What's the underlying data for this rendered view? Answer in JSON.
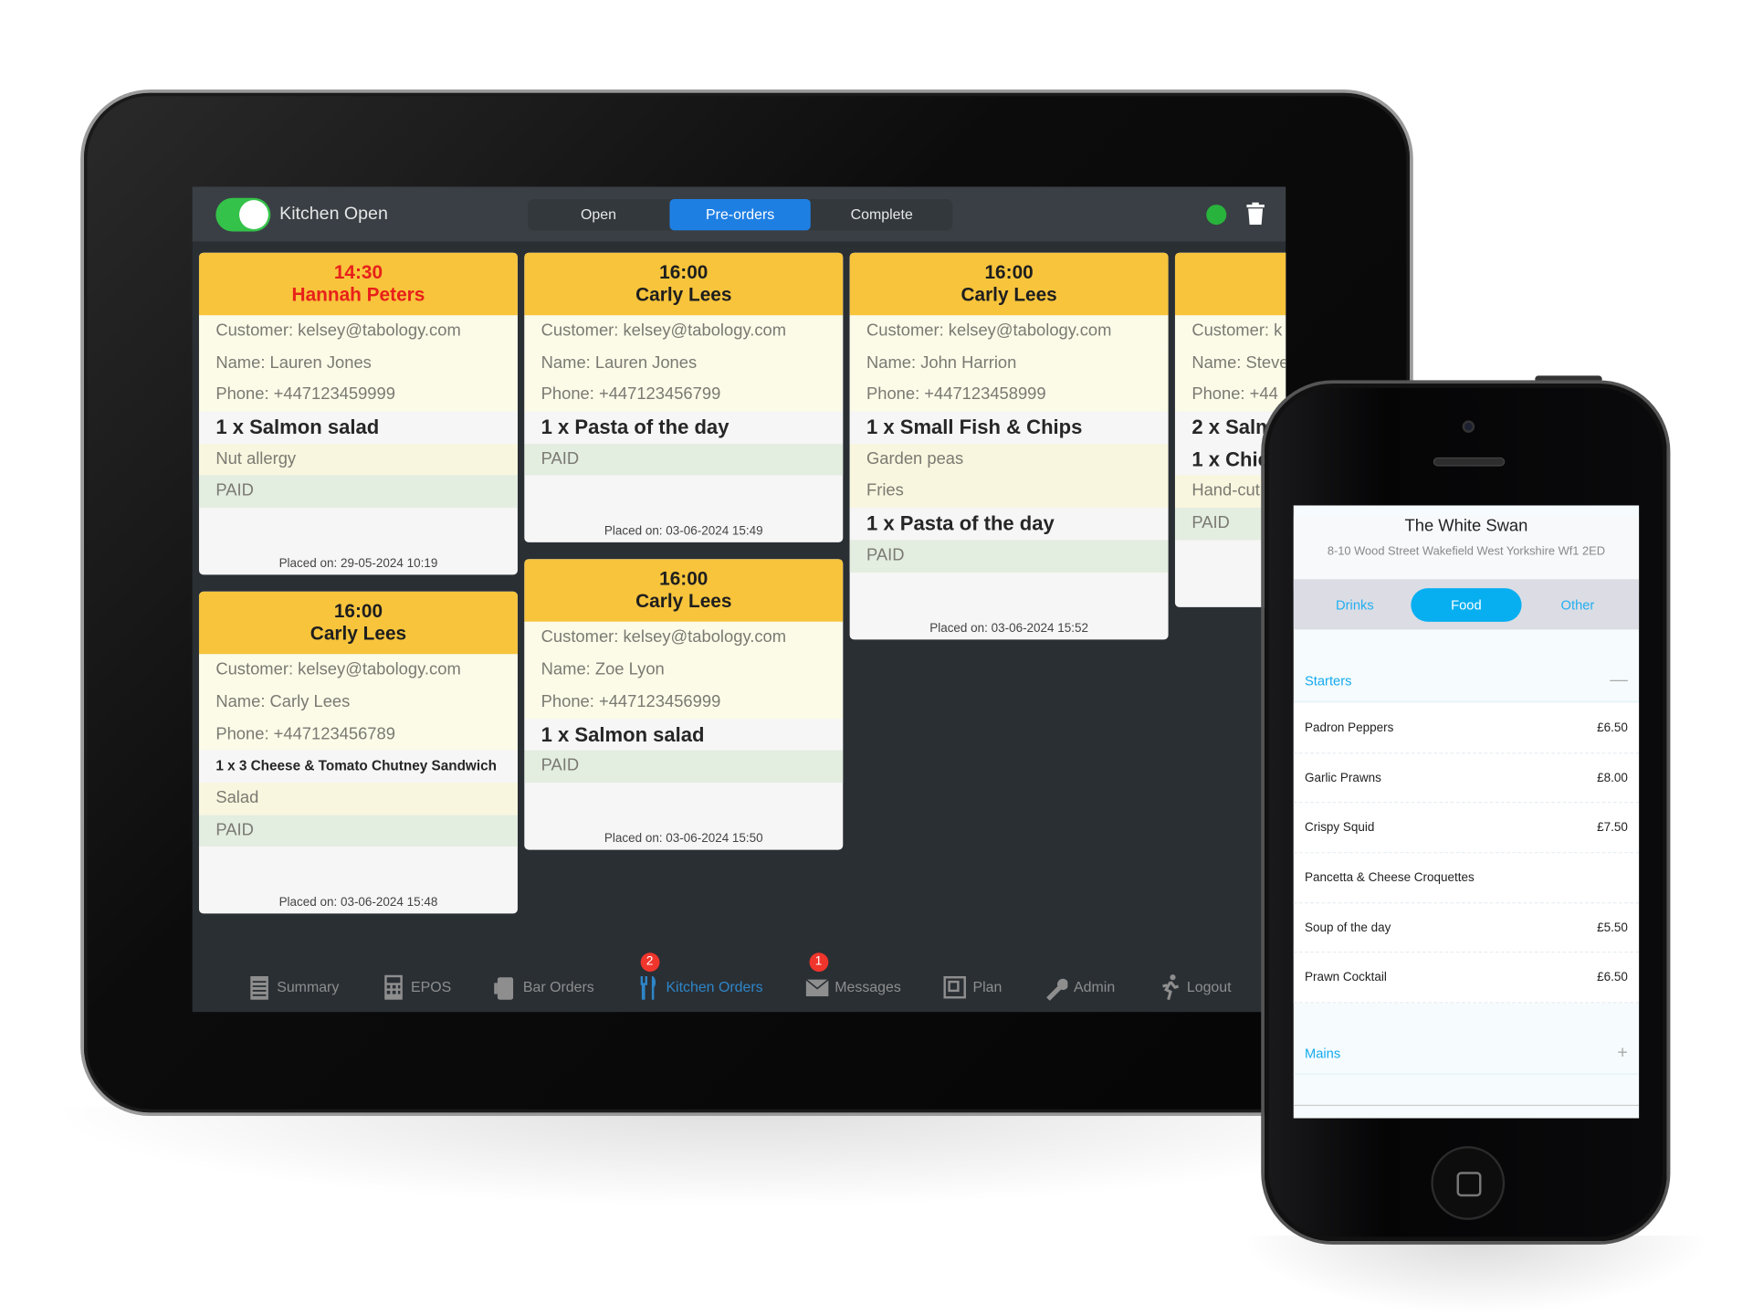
{
  "tablet": {
    "kitchen_toggle": {
      "label": "Kitchen Open",
      "on": true
    },
    "tabs": [
      {
        "label": "Open",
        "active": false
      },
      {
        "label": "Pre-orders",
        "active": true
      },
      {
        "label": "Complete",
        "active": false
      }
    ],
    "status_color": "#28b33c",
    "columns": [
      [
        {
          "time": "14:30",
          "name": "Hannah Peters",
          "late": true,
          "rows": [
            {
              "text": "Customer: kelsey@tabology.com",
              "type": "info"
            },
            {
              "text": "Name: Lauren Jones",
              "type": "info"
            },
            {
              "text": "Phone: +447123459999",
              "type": "info"
            },
            {
              "text": "1 x Salmon salad",
              "type": "item"
            },
            {
              "text": "Nut allergy",
              "type": "note"
            },
            {
              "text": "PAID",
              "type": "paid"
            }
          ],
          "placed": "Placed on: 29-05-2024 10:19"
        },
        {
          "time": "16:00",
          "name": "Carly Lees",
          "late": false,
          "rows": [
            {
              "text": "Customer: kelsey@tabology.com",
              "type": "info"
            },
            {
              "text": "Name: Carly Lees",
              "type": "info"
            },
            {
              "text": "Phone: +447123456789",
              "type": "info"
            },
            {
              "text": "1 x 3 Cheese & Tomato Chutney Sandwich",
              "type": "item-small"
            },
            {
              "text": "Salad",
              "type": "note"
            },
            {
              "text": "PAID",
              "type": "paid"
            }
          ],
          "placed": "Placed on: 03-06-2024 15:48"
        }
      ],
      [
        {
          "time": "16:00",
          "name": "Carly Lees",
          "late": false,
          "rows": [
            {
              "text": "Customer: kelsey@tabology.com",
              "type": "info"
            },
            {
              "text": "Name: Lauren Jones",
              "type": "info"
            },
            {
              "text": "Phone: +447123456799",
              "type": "info"
            },
            {
              "text": "1 x Pasta of the day",
              "type": "item"
            },
            {
              "text": "PAID",
              "type": "paid"
            }
          ],
          "placed": "Placed on: 03-06-2024 15:49"
        },
        {
          "time": "16:00",
          "name": "Carly Lees",
          "late": false,
          "rows": [
            {
              "text": "Customer: kelsey@tabology.com",
              "type": "info"
            },
            {
              "text": "Name: Zoe Lyon",
              "type": "info"
            },
            {
              "text": "Phone: +447123456999",
              "type": "info"
            },
            {
              "text": "1 x Salmon salad",
              "type": "item"
            },
            {
              "text": "PAID",
              "type": "paid"
            }
          ],
          "placed": "Placed on: 03-06-2024 15:50"
        }
      ],
      [
        {
          "time": "16:00",
          "name": "Carly Lees",
          "late": false,
          "rows": [
            {
              "text": "Customer: kelsey@tabology.com",
              "type": "info"
            },
            {
              "text": "Name: John Harrion",
              "type": "info"
            },
            {
              "text": "Phone: +447123458999",
              "type": "info"
            },
            {
              "text": "1 x Small Fish & Chips",
              "type": "item"
            },
            {
              "text": "Garden peas",
              "type": "note"
            },
            {
              "text": "Fries",
              "type": "note"
            },
            {
              "text": "1 x Pasta of the day",
              "type": "item"
            },
            {
              "text": "PAID",
              "type": "paid"
            }
          ],
          "placed": "Placed on: 03-06-2024 15:52"
        }
      ],
      [
        {
          "time": "",
          "name": "",
          "late": false,
          "rows": [
            {
              "text": "Customer: k",
              "type": "info"
            },
            {
              "text": "Name: Steve",
              "type": "info"
            },
            {
              "text": "Phone: +44",
              "type": "info"
            },
            {
              "text": "2 x Salm",
              "type": "item"
            },
            {
              "text": "1 x Chic",
              "type": "item"
            },
            {
              "text": "Hand-cut",
              "type": "note"
            },
            {
              "text": "PAID",
              "type": "paid"
            }
          ],
          "placed": "P"
        }
      ]
    ],
    "nav": [
      {
        "label": "Summary",
        "icon": "summary-icon",
        "active": false
      },
      {
        "label": "EPOS",
        "icon": "calculator-icon",
        "active": false
      },
      {
        "label": "Bar Orders",
        "icon": "beer-icon",
        "active": false
      },
      {
        "label": "Kitchen Orders",
        "icon": "fork-knife-icon",
        "active": true,
        "badge": "2"
      },
      {
        "label": "Messages",
        "icon": "envelope-icon",
        "active": false,
        "badge": "1"
      },
      {
        "label": "Plan",
        "icon": "plan-icon",
        "active": false
      },
      {
        "label": "Admin",
        "icon": "wrench-icon",
        "active": false
      },
      {
        "label": "Logout",
        "icon": "running-man-icon",
        "active": false
      }
    ]
  },
  "phone": {
    "venue": "The White Swan",
    "address": "8-10 Wood Street Wakefield West Yorkshire Wf1 2ED",
    "tabs": [
      {
        "label": "Drinks",
        "active": false
      },
      {
        "label": "Food",
        "active": true
      },
      {
        "label": "Other",
        "active": false
      }
    ],
    "categories": [
      {
        "name": "Starters",
        "expanded": true,
        "sign": "—"
      },
      {
        "name": "Mains",
        "expanded": false,
        "sign": "+"
      }
    ],
    "items": [
      {
        "name": "Padron Peppers",
        "price": "£6.50"
      },
      {
        "name": "Garlic Prawns",
        "price": "£8.00"
      },
      {
        "name": "Crispy Squid",
        "price": "£7.50"
      },
      {
        "name": "Pancetta & Cheese Croquettes",
        "price": ""
      },
      {
        "name": "Soup of the day",
        "price": "£5.50"
      },
      {
        "name": "Prawn Cocktail",
        "price": "£6.50"
      }
    ],
    "accent": "#07aff0"
  }
}
